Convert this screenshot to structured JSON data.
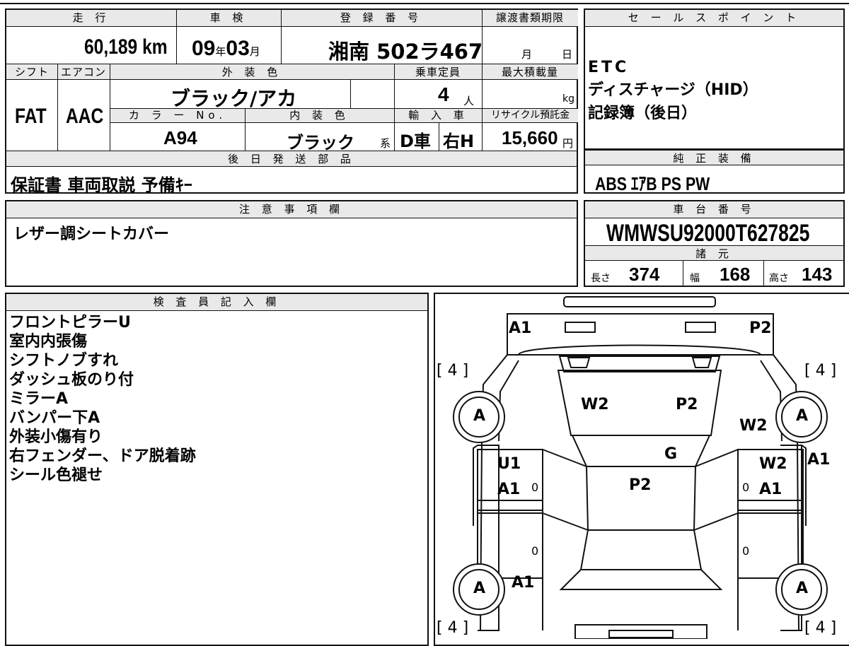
{
  "top": {
    "mileage_label": "走 行",
    "mileage": "60,189 km",
    "inspection_label": "車 検",
    "inspection_year": "09",
    "inspection_year_unit": "年",
    "inspection_month": "03",
    "inspection_month_unit": "月",
    "registration_label": "登 録 番 号",
    "registration": "湘南 502ラ467",
    "transfer_label": "譲渡書類期限",
    "transfer_month": "月",
    "transfer_day": "日",
    "shift_label": "シフト",
    "shift": "FAT",
    "ac_label": "エアコン",
    "ac": "AAC",
    "exterior_label": "外 装 色",
    "exterior": "ブラック/アカ",
    "capacity_label": "乗車定員",
    "capacity": "4",
    "capacity_unit": "人",
    "load_label": "最大積載量",
    "load_unit": "kg",
    "color_no_label": "カ ラ ー No.",
    "color_no": "A94",
    "interior_label": "内 装 色",
    "interior": "ブラック",
    "interior_unit": "系",
    "import_label": "輸 入 車",
    "import_d": "D車",
    "import_h": "右H",
    "recycle_label": "リサイクル預託金",
    "recycle": "15,660",
    "recycle_unit": "円",
    "later_label": "後 日 発 送 部 品",
    "later": "保証書 車両取説 予備ｷｰ"
  },
  "sales": {
    "label": "セ ー ル ス ポ イ ン ト",
    "lines": [
      "ETC",
      "ディスチャージ（HID）",
      "記録簿（後日）"
    ]
  },
  "equipment": {
    "label": "純 正 装 備",
    "value": "ABS ｴｱB PS PW"
  },
  "caution": {
    "label": "注 意 事 項 欄",
    "value": "レザー調シートカバー"
  },
  "chassis": {
    "label": "車 台 番 号",
    "value": "WMWSU92000T627825",
    "specs_label": "諸 元",
    "length_label": "長さ",
    "length": "374",
    "width_label": "幅",
    "width": "168",
    "height_label": "高さ",
    "height": "143"
  },
  "inspector": {
    "label": "検 査 員 記 入 欄",
    "lines": [
      "フロントピラーU",
      "室内内張傷",
      "シフトノブすれ",
      "ダッシュ板のり付",
      "ミラーA",
      "バンパー下A",
      "外装小傷有り",
      "右フェンダー、ドア脱着跡",
      "シール色褪せ"
    ]
  },
  "diagram": {
    "codes": {
      "front_left": "A1",
      "front_right": "P2",
      "hood_left": "W2",
      "hood_right": "P2",
      "right_fender": "W2",
      "windshield": "G",
      "left_door_1": "U1",
      "left_door_2": "A1",
      "roof": "P2",
      "right_door_1": "W2",
      "right_door_2": "A1",
      "right_pillar": "A1",
      "rear_left": "A1"
    },
    "wheels": [
      "A",
      "A",
      "A",
      "A"
    ],
    "tire_labels": [
      "[ 4 ]",
      "[ 4 ]",
      "[ 4 ]",
      "[ 4 ]"
    ],
    "zeros": [
      "0",
      "0",
      "0",
      "0"
    ]
  }
}
